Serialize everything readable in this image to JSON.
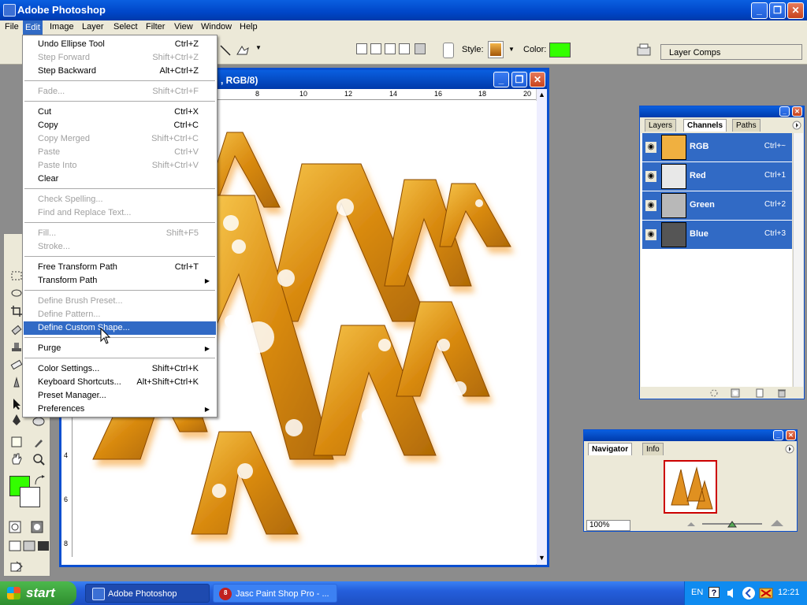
{
  "window": {
    "title": "Adobe Photoshop",
    "minimize_label": "_",
    "maximize_label": "❐",
    "close_label": "✕"
  },
  "menubar": {
    "items": [
      "File",
      "Edit",
      "Image",
      "Layer",
      "Select",
      "Filter",
      "View",
      "Window",
      "Help"
    ],
    "active": "Edit"
  },
  "options": {
    "style_label": "Style:",
    "color_label": "Color:",
    "color_value": "#33ff00",
    "layer_comps_tab": "Layer Comps"
  },
  "document": {
    "title_visible": ", RGB/8)",
    "ruler_top": [
      "8",
      "10",
      "12",
      "14",
      "16",
      "18",
      "20"
    ],
    "ruler_left": [
      "4",
      "6",
      "8"
    ]
  },
  "edit_menu": {
    "items": [
      {
        "label": "Undo Ellipse Tool",
        "shortcut": "Ctrl+Z",
        "disabled": false
      },
      {
        "label": "Step Forward",
        "shortcut": "Shift+Ctrl+Z",
        "disabled": true
      },
      {
        "label": "Step Backward",
        "shortcut": "Alt+Ctrl+Z",
        "disabled": false
      },
      {
        "label": "Fade...",
        "shortcut": "Shift+Ctrl+F",
        "disabled": true
      },
      {
        "label": "Cut",
        "shortcut": "Ctrl+X",
        "disabled": false
      },
      {
        "label": "Copy",
        "shortcut": "Ctrl+C",
        "disabled": false
      },
      {
        "label": "Copy Merged",
        "shortcut": "Shift+Ctrl+C",
        "disabled": true
      },
      {
        "label": "Paste",
        "shortcut": "Ctrl+V",
        "disabled": true
      },
      {
        "label": "Paste Into",
        "shortcut": "Shift+Ctrl+V",
        "disabled": true
      },
      {
        "label": "Clear",
        "shortcut": "",
        "disabled": false
      },
      {
        "label": "Check Spelling...",
        "shortcut": "",
        "disabled": true
      },
      {
        "label": "Find and Replace Text...",
        "shortcut": "",
        "disabled": true
      },
      {
        "label": "Fill...",
        "shortcut": "Shift+F5",
        "disabled": true
      },
      {
        "label": "Stroke...",
        "shortcut": "",
        "disabled": true
      },
      {
        "label": "Free Transform Path",
        "shortcut": "Ctrl+T",
        "disabled": false
      },
      {
        "label": "Transform Path",
        "shortcut": "",
        "disabled": false,
        "submenu": true
      },
      {
        "label": "Define Brush Preset...",
        "shortcut": "",
        "disabled": true
      },
      {
        "label": "Define Pattern...",
        "shortcut": "",
        "disabled": true
      },
      {
        "label": "Define Custom Shape...",
        "shortcut": "",
        "disabled": false,
        "highlighted": true
      },
      {
        "label": "Purge",
        "shortcut": "",
        "disabled": false,
        "submenu": true
      },
      {
        "label": "Color Settings...",
        "shortcut": "Shift+Ctrl+K",
        "disabled": false
      },
      {
        "label": "Keyboard Shortcuts...",
        "shortcut": "Alt+Shift+Ctrl+K",
        "disabled": false
      },
      {
        "label": "Preset Manager...",
        "shortcut": "",
        "disabled": false
      },
      {
        "label": "Preferences",
        "shortcut": "",
        "disabled": false,
        "submenu": true
      }
    ]
  },
  "channels_panel": {
    "tabs": [
      "Layers",
      "Channels",
      "Paths"
    ],
    "active_tab": "Channels",
    "channels": [
      {
        "name": "RGB",
        "shortcut": "Ctrl+~"
      },
      {
        "name": "Red",
        "shortcut": "Ctrl+1"
      },
      {
        "name": "Green",
        "shortcut": "Ctrl+2"
      },
      {
        "name": "Blue",
        "shortcut": "Ctrl+3"
      }
    ]
  },
  "navigator_panel": {
    "tabs": [
      "Navigator",
      "Info"
    ],
    "active_tab": "Navigator",
    "zoom": "100%"
  },
  "taskbar": {
    "start_label": "start",
    "items": [
      {
        "label": "Adobe Photoshop",
        "active": true
      },
      {
        "label": "Jasc Paint Shop Pro - ...",
        "active": false,
        "badge": "8"
      }
    ],
    "tray": {
      "language": "EN",
      "help": "?",
      "clock": "12:21"
    }
  },
  "colors": {
    "accent": "#316ac5",
    "titlebar": "#0046c8",
    "foreground_color": "#33ff00",
    "menu_bg": "#ece9d8"
  }
}
